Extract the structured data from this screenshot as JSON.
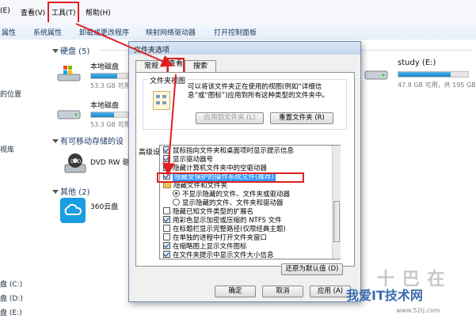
{
  "menubar": {
    "items": [
      "(E)",
      "查看(V)",
      "工具(T)",
      "帮助(H)"
    ]
  },
  "toolbar": {
    "items": [
      "属性",
      "系统属性",
      "卸载或更改程序",
      "映射网络驱动器",
      "打开控制面板"
    ]
  },
  "navpane": {
    "items": [
      "的位置",
      "视库",
      "",
      "",
      "盘 (C:)",
      "盘 (D:)",
      "盘 (E:)"
    ]
  },
  "sections": {
    "hard_disks": "硬盘 (5)",
    "removable": "有可移动存储的设",
    "other": "其他 (2)"
  },
  "drives": [
    {
      "name": "本地磁盘",
      "size": "53.3 GB 可用",
      "fill": 0.72
    },
    {
      "name": "本地磁盘",
      "size": "53.3 GB 可用",
      "fill": 0.62
    },
    {
      "name": "study (E:)",
      "size": "47.8 GB 可用，共 195 GB",
      "fill": 0.75
    },
    {
      "name": "DVD RW 驱",
      "size": "",
      "fill": null
    },
    {
      "name": "360云盘",
      "size": "",
      "fill": null
    }
  ],
  "dialog": {
    "title": "文件夹选项",
    "tabs": [
      "常规",
      "查看",
      "搜索"
    ],
    "folder_view": {
      "legend": "文件夹视图",
      "description": "可以将该文件夹正在使用的视图(例如“详细信息”或“图标”)应用到所有这种类型的文件夹中。",
      "apply_button": "应用到文件夹 (L)",
      "reset_button": "重置文件夹 (R)"
    },
    "advanced_label": "高级设置:",
    "options": [
      {
        "type": "checkbox",
        "checked": true,
        "label": "鼠标指向文件夹和桌面项时显示提示信息",
        "indent": 0
      },
      {
        "type": "checkbox",
        "checked": true,
        "label": "显示驱动器号",
        "indent": 0
      },
      {
        "type": "checkbox",
        "checked": true,
        "label": "隐藏计算机文件夹中的空驱动器",
        "indent": 0
      },
      {
        "type": "checkbox",
        "checked": true,
        "label": "隐藏受保护的操作系统文件(推荐)",
        "indent": 0,
        "selected": true
      },
      {
        "type": "folder",
        "label": "隐藏文件和文件夹",
        "indent": 0
      },
      {
        "type": "radio",
        "checked": true,
        "label": "不显示隐藏的文件、文件夹或驱动器",
        "indent": 1
      },
      {
        "type": "radio",
        "checked": false,
        "label": "显示隐藏的文件、文件夹和驱动器",
        "indent": 1
      },
      {
        "type": "checkbox",
        "checked": false,
        "label": "隐藏已知文件类型的扩展名",
        "indent": 0
      },
      {
        "type": "checkbox",
        "checked": true,
        "label": "用彩色显示加密或压缩的 NTFS 文件",
        "indent": 0
      },
      {
        "type": "checkbox",
        "checked": false,
        "label": "在标题栏显示完整路径(仅限经典主题)",
        "indent": 0
      },
      {
        "type": "checkbox",
        "checked": false,
        "label": "在单独的进程中打开文件夹窗口",
        "indent": 0
      },
      {
        "type": "checkbox",
        "checked": true,
        "label": "在缩略图上显示文件图标",
        "indent": 0
      },
      {
        "type": "checkbox",
        "checked": true,
        "label": "在文件夹提示中显示文件大小信息",
        "indent": 0
      }
    ],
    "restore_button": "还原为默认值 (D)",
    "ok_button": "确定",
    "cancel_button": "取消",
    "apply_button": "应用 (A)"
  },
  "watermark": {
    "big": "十 巴 在",
    "cn": "我爱IT技术网",
    "url": "www.52ij.com"
  },
  "colors": {
    "annotation_red": "#e02020",
    "selection_blue": "#3399ff"
  }
}
